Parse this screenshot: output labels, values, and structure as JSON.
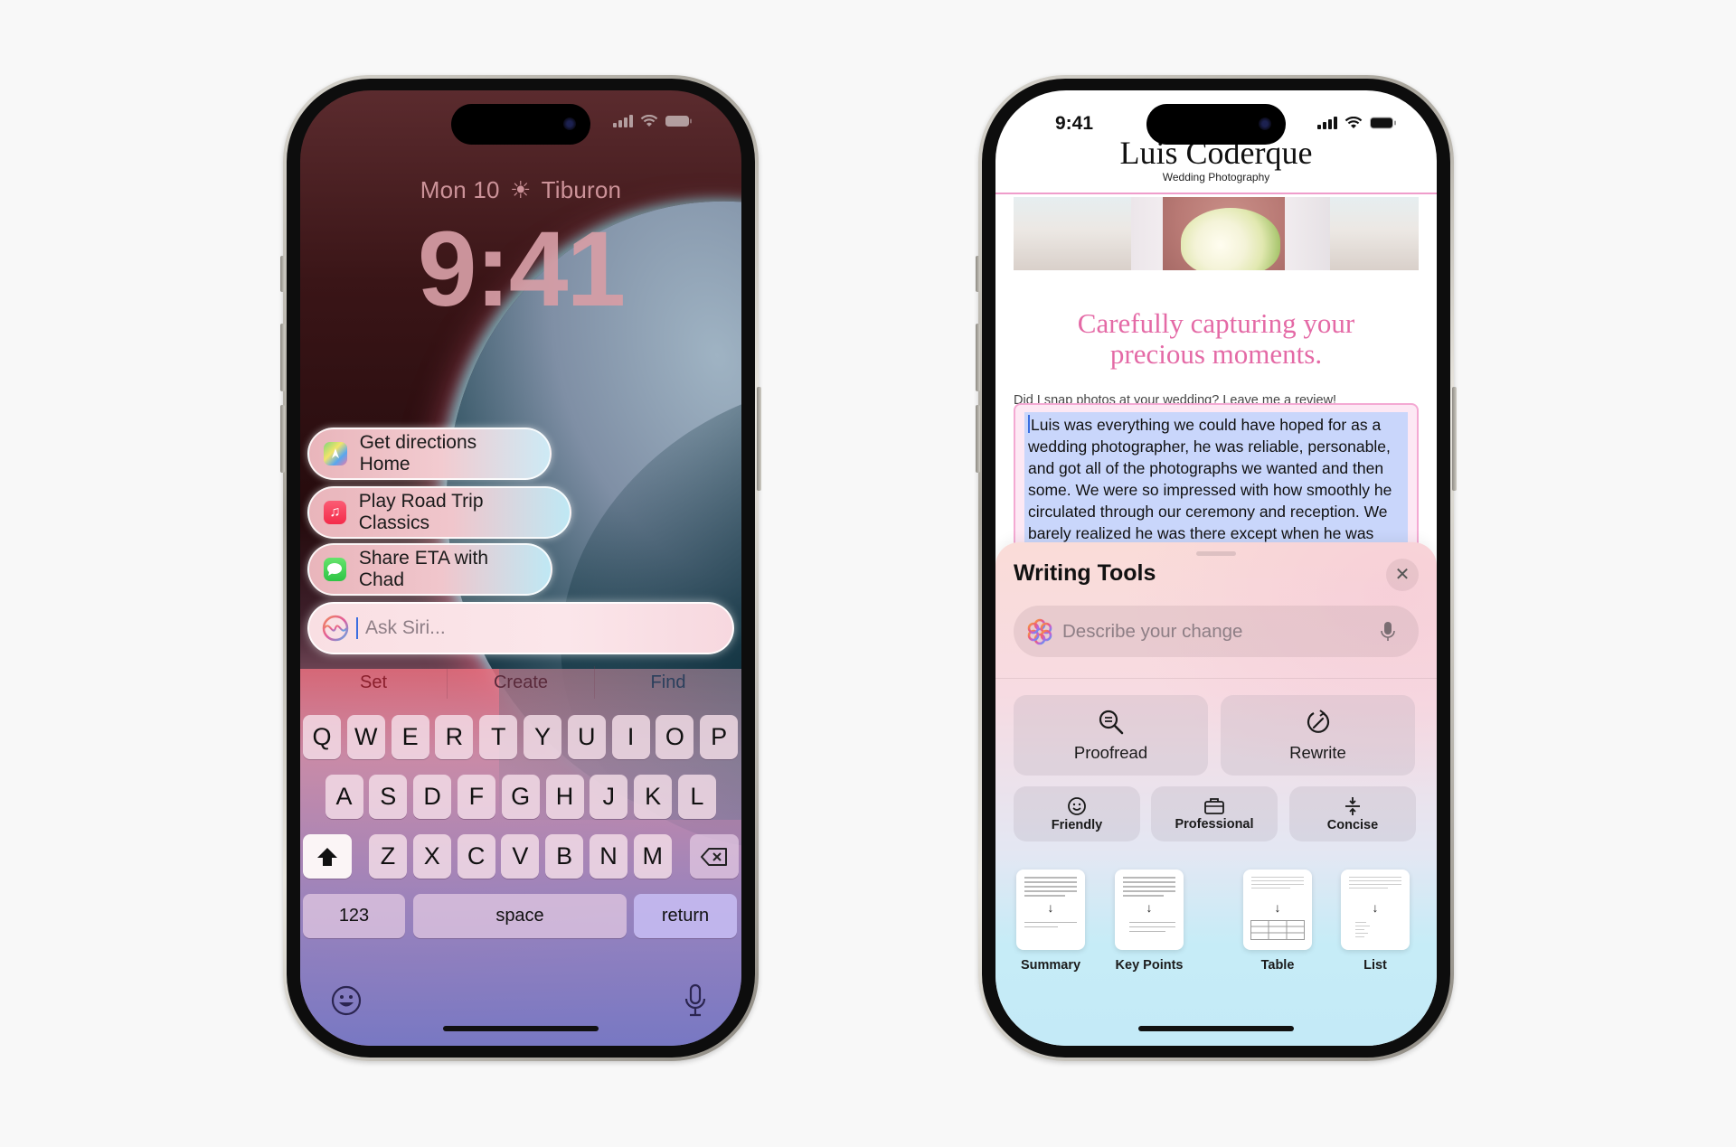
{
  "left_phone": {
    "status_bar": {
      "signal_icon": "cellular-signal-icon",
      "wifi_icon": "wifi-icon",
      "battery_icon": "battery-icon"
    },
    "lock_screen": {
      "date": "Mon 10",
      "weather_icon": "sun-icon",
      "location": "Tiburon",
      "time": "9:41"
    },
    "siri_suggestions": [
      {
        "label": "Get directions Home",
        "icon": "maps-app-icon"
      },
      {
        "label": "Play Road Trip Classics",
        "icon": "music-app-icon"
      },
      {
        "label": "Share ETA with Chad",
        "icon": "messages-app-icon"
      }
    ],
    "siri_input": {
      "placeholder": "Ask Siri...",
      "icon": "siri-icon"
    },
    "predictive_bar": [
      "Set",
      "Create",
      "Find"
    ],
    "keyboard": {
      "row1": [
        "Q",
        "W",
        "E",
        "R",
        "T",
        "Y",
        "U",
        "I",
        "O",
        "P"
      ],
      "row2": [
        "A",
        "S",
        "D",
        "F",
        "G",
        "H",
        "J",
        "K",
        "L"
      ],
      "row3": [
        "Z",
        "X",
        "C",
        "V",
        "B",
        "N",
        "M"
      ],
      "shift_icon": "shift-icon",
      "delete_icon": "delete-icon",
      "numbers_label": "123",
      "space_label": "space",
      "return_label": "return",
      "emoji_icon": "emoji-icon",
      "dictation_icon": "microphone-icon"
    }
  },
  "right_phone": {
    "status_bar": {
      "time": "9:41"
    },
    "website": {
      "title": "Luis Coderque",
      "subtitle": "Wedding Photography",
      "headline_line1": "Carefully capturing your",
      "headline_line2": "precious moments.",
      "review_prompt": "Did I snap photos at your wedding? Leave me a review!",
      "review_text": "Luis was everything we could have hoped for as a wedding photographer, he was reliable, personable, and got all of the photographs we wanted and then some. We were so impressed with how smoothly he circulated through our ceremony and reception. We barely realized he was there except when he was very"
    },
    "writing_tools": {
      "title": "Writing Tools",
      "close_icon": "close-icon",
      "input_placeholder": "Describe your change",
      "primary_tools": [
        {
          "label": "Proofread",
          "icon": "proofread-icon"
        },
        {
          "label": "Rewrite",
          "icon": "rewrite-icon"
        }
      ],
      "tone_tools": [
        {
          "label": "Friendly",
          "icon": "smiley-icon"
        },
        {
          "label": "Professional",
          "icon": "briefcase-icon"
        },
        {
          "label": "Concise",
          "icon": "compress-icon"
        }
      ],
      "format_tools": [
        {
          "label": "Summary"
        },
        {
          "label": "Key Points"
        },
        {
          "label": "Table"
        },
        {
          "label": "List"
        }
      ]
    }
  },
  "colors": {
    "page_background": "#f8f8f8",
    "headline_pink": "#e46aa6",
    "selection_blue": "#c9d6fb",
    "caret_blue": "#3b6ee0"
  }
}
